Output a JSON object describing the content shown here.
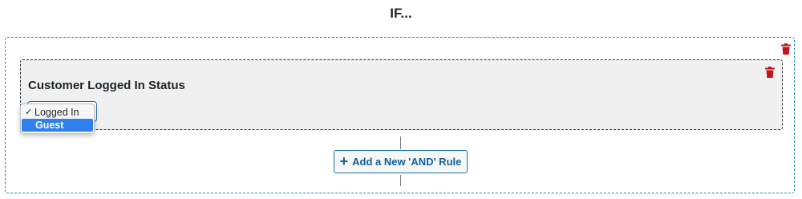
{
  "heading": "IF...",
  "icons": {
    "delete": "trash-icon",
    "add": "plus-icon",
    "selected": "checkmark-icon"
  },
  "colors": {
    "delete_red": "#c0141c",
    "accent_blue": "#2271b1",
    "highlight_blue": "#2f80ec"
  },
  "rule": {
    "title": "Customer Logged In Status",
    "select": {
      "selected": "Logged In",
      "options": [
        "Logged In",
        "Guest"
      ],
      "highlighted": "Guest"
    }
  },
  "add_and_button": {
    "icon_glyph": "+",
    "label": "Add a New 'AND' Rule"
  }
}
